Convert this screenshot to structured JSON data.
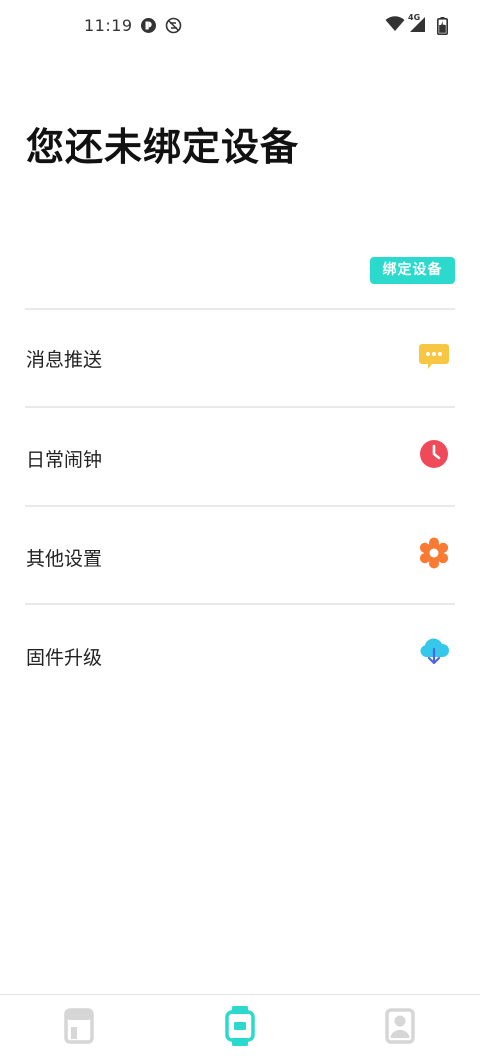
{
  "status_bar": {
    "time": "11:19",
    "network": "4G",
    "icons": [
      "app-indicator-icon",
      "no-sync-icon",
      "wifi-icon",
      "cellular-signal-icon",
      "battery-icon"
    ]
  },
  "page": {
    "title": "您还未绑定设备",
    "bind_button_label": "绑定设备"
  },
  "menu": {
    "items": [
      {
        "label": "消息推送",
        "icon": "message-icon",
        "icon_color": "#f7c744"
      },
      {
        "label": "日常闹钟",
        "icon": "clock-icon",
        "icon_color": "#f04a5a"
      },
      {
        "label": "其他设置",
        "icon": "gear-icon",
        "icon_color": "#fa7a33"
      },
      {
        "label": "固件升级",
        "icon": "cloud-download-icon",
        "icon_color": "#35c8ea"
      }
    ]
  },
  "bottom_nav": {
    "tabs": [
      {
        "name": "home",
        "icon": "card-icon",
        "active": false
      },
      {
        "name": "device",
        "icon": "watch-icon",
        "active": true
      },
      {
        "name": "profile",
        "icon": "user-icon",
        "active": false
      }
    ],
    "active_color": "#2bd9cd",
    "inactive_color": "#d6d6d6"
  },
  "colors": {
    "accent": "#2bd9cd",
    "divider": "#e9e9e9"
  }
}
